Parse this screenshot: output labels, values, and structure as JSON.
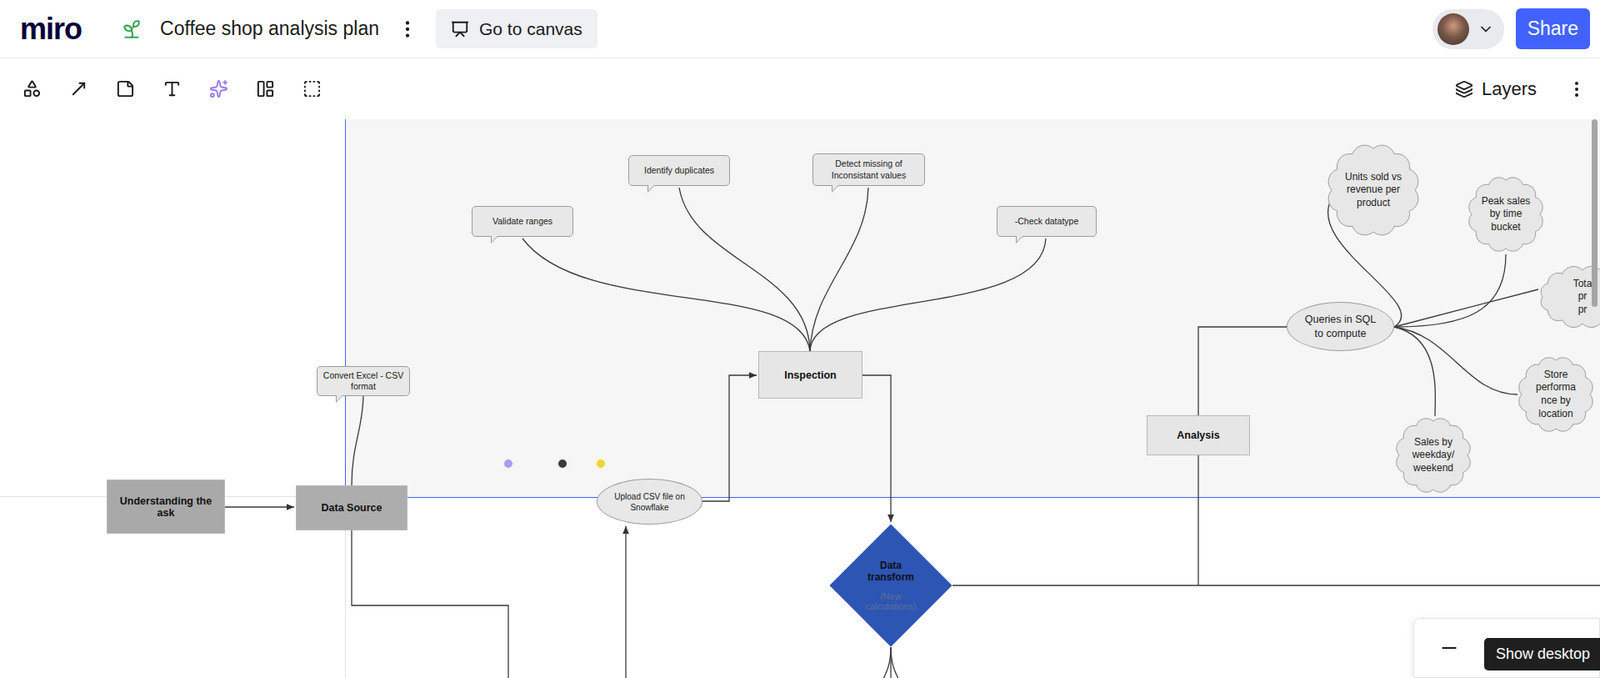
{
  "header": {
    "logo": "miro",
    "board_title": "Coffee shop analysis plan",
    "canvas_button": "Go to canvas",
    "share_button": "Share"
  },
  "toolbar": {
    "layers": "Layers"
  },
  "frame": {
    "selected": true
  },
  "nodes": [
    {
      "kind": "rect",
      "text": "Understanding the ask",
      "color": "#a9a9a9"
    },
    {
      "kind": "rect",
      "text": "Data Source",
      "color": "#adadad"
    },
    {
      "kind": "bubble",
      "text": "Convert Excel - CSV format"
    },
    {
      "kind": "ellipse",
      "text": "Upload CSV file on Snowflake"
    },
    {
      "kind": "rect",
      "text": "Inspection",
      "color": "#e6e6e6"
    },
    {
      "kind": "bubble",
      "text": "Validate ranges"
    },
    {
      "kind": "bubble",
      "text": "Identify duplicates"
    },
    {
      "kind": "bubble",
      "text": "Detect missing of Inconsistant values"
    },
    {
      "kind": "bubble",
      "text": "-Check datatype"
    },
    {
      "kind": "diamond",
      "text": "Data transform",
      "note": "(New calculations)"
    },
    {
      "kind": "rect",
      "text": "Analysis",
      "color": "#e6e6e6"
    },
    {
      "kind": "ellipse",
      "text": "Queries in SQL to compute"
    },
    {
      "kind": "cloud",
      "lines": [
        "Units sold vs",
        "revenue per",
        "product"
      ]
    },
    {
      "kind": "cloud",
      "lines": [
        "Peak sales",
        "by time",
        "bucket"
      ]
    },
    {
      "kind": "cloud",
      "lines": [
        "Tota",
        "pr",
        "pr"
      ]
    },
    {
      "kind": "cloud",
      "lines": [
        "Store",
        "performa",
        "nce by",
        "location"
      ]
    },
    {
      "kind": "cloud",
      "lines": [
        "Sales by",
        "weekday/",
        "weekend"
      ]
    }
  ],
  "dots": [
    {
      "color": "#a99cf6"
    },
    {
      "color": "#3a3a3a"
    },
    {
      "color": "#f5d533"
    }
  ],
  "zoom": {
    "tooltip": "Show desktop"
  }
}
